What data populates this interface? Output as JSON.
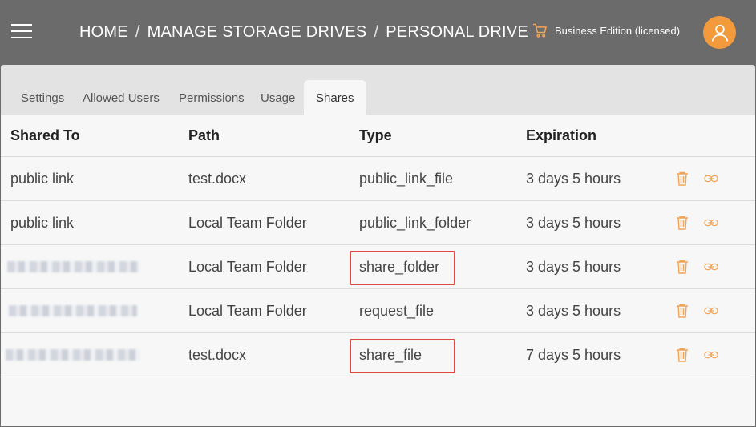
{
  "header": {
    "breadcrumb": [
      "HOME",
      "MANAGE STORAGE DRIVES",
      "PERSONAL DRIVE"
    ],
    "separator": "/",
    "edition": "Business Edition (licensed)"
  },
  "tabs": [
    {
      "label": "Settings",
      "active": false
    },
    {
      "label": "Allowed Users",
      "active": false
    },
    {
      "label": "Permissions",
      "active": false
    },
    {
      "label": "Usage",
      "active": false
    },
    {
      "label": "Shares",
      "active": true
    }
  ],
  "table": {
    "columns": [
      "Shared To",
      "Path",
      "Type",
      "Expiration"
    ],
    "rows": [
      {
        "shared_to": "public link",
        "path": "test.docx",
        "type": "public_link_file",
        "expiration": "3 days 5 hours"
      },
      {
        "shared_to": "public link",
        "path": "Local Team Folder",
        "type": "public_link_folder",
        "expiration": "3 days 5 hours"
      },
      {
        "shared_to": "",
        "path": "Local Team Folder",
        "type": "share_folder",
        "expiration": "3 days 5 hours",
        "highlighted": true
      },
      {
        "shared_to": "",
        "path": "Local Team Folder",
        "type": "request_file",
        "expiration": "3 days 5 hours"
      },
      {
        "shared_to": "",
        "path": "test.docx",
        "type": "share_file",
        "expiration": "7 days 5 hours",
        "highlighted": true
      }
    ]
  },
  "colors": {
    "topbar": "#6b6b6b",
    "accent": "#f39a3c",
    "icon": "#f0a55a",
    "highlight": "#e04848"
  },
  "icons": {
    "menu": "hamburger-icon",
    "cart": "cart-icon",
    "user": "user-icon",
    "delete": "trash-icon",
    "link": "link-icon"
  }
}
